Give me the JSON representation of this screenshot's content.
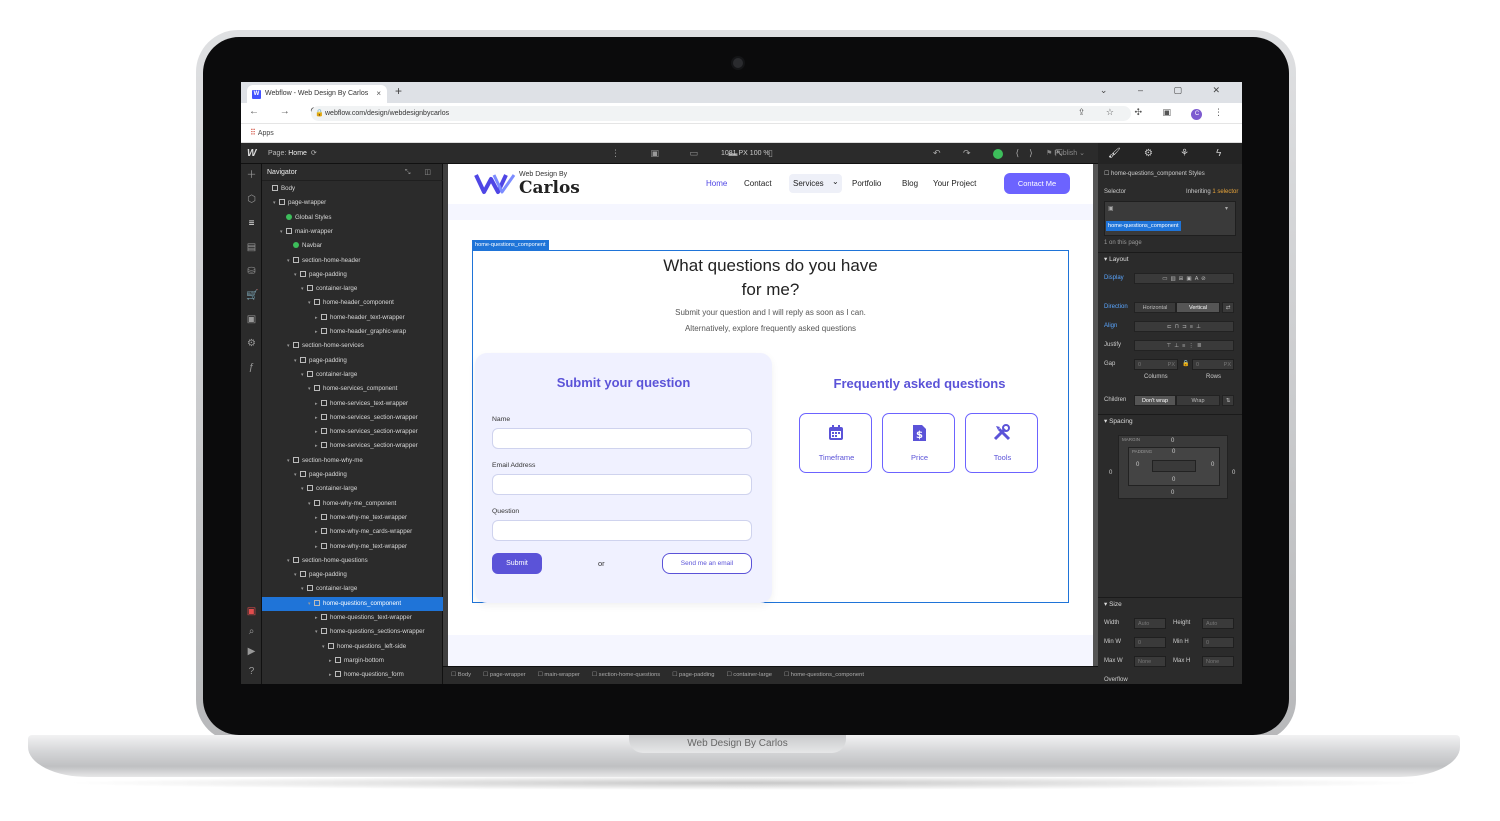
{
  "browser": {
    "tab_title": "Webflow - Web Design By Carlos",
    "tab_close": "×",
    "new_tab": "+",
    "url": "webflow.com/design/webdesignbycarlos",
    "bookmark": "Apps",
    "avatar_letter": "C"
  },
  "designer": {
    "logo": "W",
    "page_label": "Page:",
    "page_name": "Home",
    "canvas_size": "1081 PX  100 %",
    "publish": "Publish"
  },
  "navigator": {
    "title": "Navigator",
    "items": [
      {
        "label": "Body",
        "indent": 0,
        "kind": "box",
        "caret": ""
      },
      {
        "label": "page-wrapper",
        "indent": 1,
        "kind": "box",
        "caret": "▾"
      },
      {
        "label": "Global Styles",
        "indent": 2,
        "kind": "sym",
        "caret": ""
      },
      {
        "label": "main-wrapper",
        "indent": 2,
        "kind": "box",
        "caret": "▾"
      },
      {
        "label": "Navbar",
        "indent": 3,
        "kind": "sym",
        "caret": ""
      },
      {
        "label": "section-home-header",
        "indent": 3,
        "kind": "box",
        "caret": "▾"
      },
      {
        "label": "page-padding",
        "indent": 4,
        "kind": "box",
        "caret": "▾"
      },
      {
        "label": "container-large",
        "indent": 5,
        "kind": "box",
        "caret": "▾"
      },
      {
        "label": "home-header_component",
        "indent": 6,
        "kind": "box",
        "caret": "▾"
      },
      {
        "label": "home-header_text-wrapper",
        "indent": 7,
        "kind": "box",
        "caret": "▸"
      },
      {
        "label": "home-header_graphic-wrap",
        "indent": 7,
        "kind": "box",
        "caret": "▸"
      },
      {
        "label": "section-home-services",
        "indent": 3,
        "kind": "box",
        "caret": "▾"
      },
      {
        "label": "page-padding",
        "indent": 4,
        "kind": "box",
        "caret": "▾"
      },
      {
        "label": "container-large",
        "indent": 5,
        "kind": "box",
        "caret": "▾"
      },
      {
        "label": "home-services_component",
        "indent": 6,
        "kind": "box",
        "caret": "▾"
      },
      {
        "label": "home-services_text-wrapper",
        "indent": 7,
        "kind": "box",
        "caret": "▸"
      },
      {
        "label": "home-services_section-wrapper",
        "indent": 7,
        "kind": "box",
        "caret": "▸"
      },
      {
        "label": "home-services_section-wrapper",
        "indent": 7,
        "kind": "box",
        "caret": "▸"
      },
      {
        "label": "home-services_section-wrapper",
        "indent": 7,
        "kind": "box",
        "caret": "▸"
      },
      {
        "label": "section-home-why-me",
        "indent": 3,
        "kind": "box",
        "caret": "▾"
      },
      {
        "label": "page-padding",
        "indent": 4,
        "kind": "box",
        "caret": "▾"
      },
      {
        "label": "container-large",
        "indent": 5,
        "kind": "box",
        "caret": "▾"
      },
      {
        "label": "home-why-me_component",
        "indent": 6,
        "kind": "box",
        "caret": "▾"
      },
      {
        "label": "home-why-me_text-wrapper",
        "indent": 7,
        "kind": "box",
        "caret": "▸"
      },
      {
        "label": "home-why-me_cards-wrapper",
        "indent": 7,
        "kind": "box",
        "caret": "▸"
      },
      {
        "label": "home-why-me_text-wrapper",
        "indent": 7,
        "kind": "box",
        "caret": "▸"
      },
      {
        "label": "section-home-questions",
        "indent": 3,
        "kind": "box",
        "caret": "▾"
      },
      {
        "label": "page-padding",
        "indent": 4,
        "kind": "box",
        "caret": "▾"
      },
      {
        "label": "container-large",
        "indent": 5,
        "kind": "box",
        "caret": "▾"
      },
      {
        "label": "home-questions_component",
        "indent": 6,
        "kind": "box",
        "caret": "▾",
        "selected": true
      },
      {
        "label": "home-questions_text-wrapper",
        "indent": 7,
        "kind": "box",
        "caret": "▸"
      },
      {
        "label": "home-questions_sections-wrapper",
        "indent": 7,
        "kind": "box",
        "caret": "▾"
      },
      {
        "label": "home-questions_left-side",
        "indent": 8,
        "kind": "box",
        "caret": "▾"
      },
      {
        "label": "margin-bottom",
        "indent": 9,
        "kind": "box",
        "caret": "▸"
      },
      {
        "label": "home-questions_form",
        "indent": 9,
        "kind": "box",
        "caret": "▸"
      }
    ]
  },
  "site": {
    "logo_sub": "Web Design By",
    "logo_main": "Carlos",
    "menu": [
      "Home",
      "Contact",
      "Services",
      "Portfolio",
      "Blog",
      "Your Project"
    ],
    "services_caret": "⌄",
    "cta": "Contact Me",
    "selected_tag": "home-questions_component",
    "heading_line1": "What questions do you have",
    "heading_line2": "for me?",
    "sub_line1": "Submit your question and I will reply as soon as I can.",
    "sub_line2": "Alternatively, explore frequently asked questions",
    "form": {
      "title": "Submit your question",
      "name_label": "Name",
      "email_label": "Email Address",
      "question_label": "Question",
      "submit": "Submit",
      "or": "or",
      "email_button": "Send me an email"
    },
    "faq": {
      "title": "Frequently asked questions",
      "cards": [
        "Timeframe",
        "Price",
        "Tools"
      ]
    }
  },
  "breadcrumb": [
    "Body",
    "page-wrapper",
    "main-wrapper",
    "section-home-questions",
    "page-padding",
    "container-large",
    "home-questions_component"
  ],
  "style_panel": {
    "element_title": "home-questions_component Styles",
    "selector_label": "Selector",
    "inheriting": "Inheriting",
    "inheriting_count": "1 selector",
    "class_pill": "home-questions_component",
    "on_page": "1 on this page",
    "layout": "Layout",
    "display": "Display",
    "direction": "Direction",
    "horizontal": "Horizontal",
    "vertical": "Vertical",
    "align": "Align",
    "justify": "Justify",
    "gap": "Gap",
    "gap_value": "0",
    "px": "PX",
    "columns": "Columns",
    "rows": "Rows",
    "children": "Children",
    "dont_wrap": "Don't wrap",
    "wrap": "Wrap",
    "spacing": "Spacing",
    "margin": "MARGIN",
    "padding": "PADDING",
    "zero": "0",
    "size": "Size",
    "width": "Width",
    "height": "Height",
    "auto": "Auto",
    "min_w": "Min W",
    "min_h": "Min H",
    "max_w": "Max W",
    "max_h": "Max H",
    "none": "None",
    "overflow": "Overflow",
    "fit": "Fit",
    "fill": "Fill",
    "position": "Position",
    "static": "Static",
    "float_clear": "Float and clear"
  },
  "laptop_label": "Web Design By Carlos",
  "colors": {
    "accent": "#5b53d8",
    "selection": "#1f74d8",
    "cta": "#6c63ff"
  }
}
